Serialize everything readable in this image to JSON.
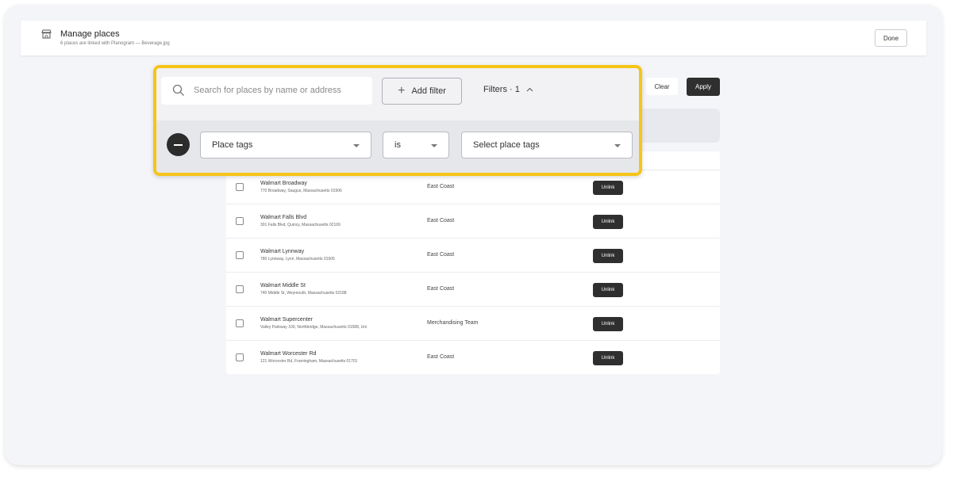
{
  "header": {
    "icon": "store-icon",
    "title": "Manage places",
    "subtitle": "6 places are linked with Planogram — Beverage.jpg",
    "done_label": "Done"
  },
  "toolbar": {
    "clear_label": "Clear",
    "apply_label": "Apply"
  },
  "filter_panel": {
    "search_placeholder": "Search for places by name or address",
    "add_filter_label": "Add filter",
    "filters_label": "Filters · 1",
    "filter": {
      "field": "Place tags",
      "operator": "is",
      "value_placeholder": "Select place tags"
    },
    "highlight_color": "#f5c518"
  },
  "places": [
    {
      "name": "Walmart Broadway",
      "address": "770 Broadway, Saugus, Massachusetts 01906",
      "tag": "East Coast",
      "action": "Unlink"
    },
    {
      "name": "Walmart Falls Blvd",
      "address": "301 Falls Blvd, Quincy, Massachusetts 02169",
      "tag": "East Coast",
      "action": "Unlink"
    },
    {
      "name": "Walmart Lynnway",
      "address": "780 Lynnway, Lynn, Massachusetts 01905",
      "tag": "East Coast",
      "action": "Unlink"
    },
    {
      "name": "Walmart Middle St",
      "address": "740 Middle St, Weymouth, Massachusetts 02188",
      "tag": "East Coast",
      "action": "Unlink"
    },
    {
      "name": "Walmart Supercenter",
      "address": "Valley Parkway 100, Northbridge, Massachusetts 01588, Uni",
      "tag": "Merchandising Team",
      "action": "Unlink"
    },
    {
      "name": "Walmart Worcester Rd",
      "address": "121 Worcester Rd, Framingham, Massachusetts 01701",
      "tag": "East Coast",
      "action": "Unlink"
    }
  ]
}
